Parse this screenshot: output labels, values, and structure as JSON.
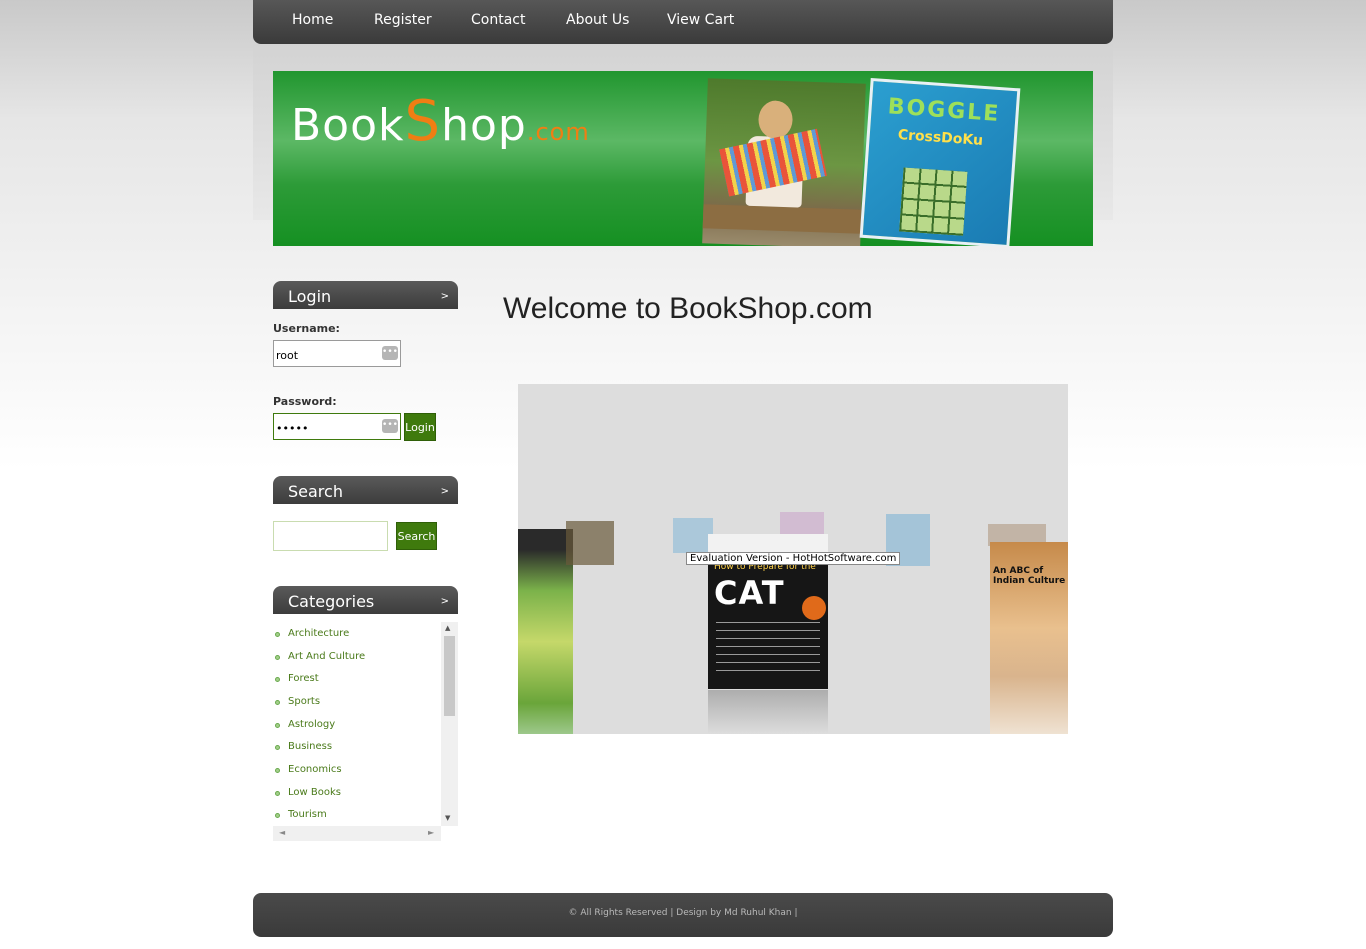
{
  "nav": {
    "items": [
      "Home",
      "Register",
      "Contact",
      "About Us",
      "View Cart"
    ]
  },
  "banner": {
    "logo_book": "Book",
    "logo_s": "S",
    "logo_hop": "hop",
    "logo_com": ".com",
    "box_title": "BOGGLE",
    "box_subtitle": "CrossDoKu"
  },
  "login": {
    "heading": "Login",
    "username_label": "Username:",
    "username_value": "root",
    "password_label": "Password:",
    "password_value": "•••••",
    "button": "Login"
  },
  "search": {
    "heading": "Search",
    "input_value": "",
    "button": "Search"
  },
  "categories": {
    "heading": "Categories",
    "items": [
      "Architecture",
      "Art And Culture",
      "Forest",
      "Sports",
      "Astrology",
      "Business",
      "Economics",
      "Low Books",
      "Tourism"
    ]
  },
  "main": {
    "welcome": "Welcome to BookShop.com",
    "watermark": "Evaluation Version - HotHotSoftware.com",
    "featured_cover_top": "How to Prepare for the",
    "featured_cover_title": "CAT",
    "right_cover_title": "An ABC of Indian Culture"
  },
  "footer": {
    "text": "© All Rights Reserved | Design by Md Ruhul Khan |"
  },
  "colors": {
    "nav_bg": "#3f3f3f",
    "banner_green": "#21962f",
    "accent_orange": "#f07e13",
    "button_green": "#3f7a0d",
    "link_green": "#4a7a1a"
  }
}
